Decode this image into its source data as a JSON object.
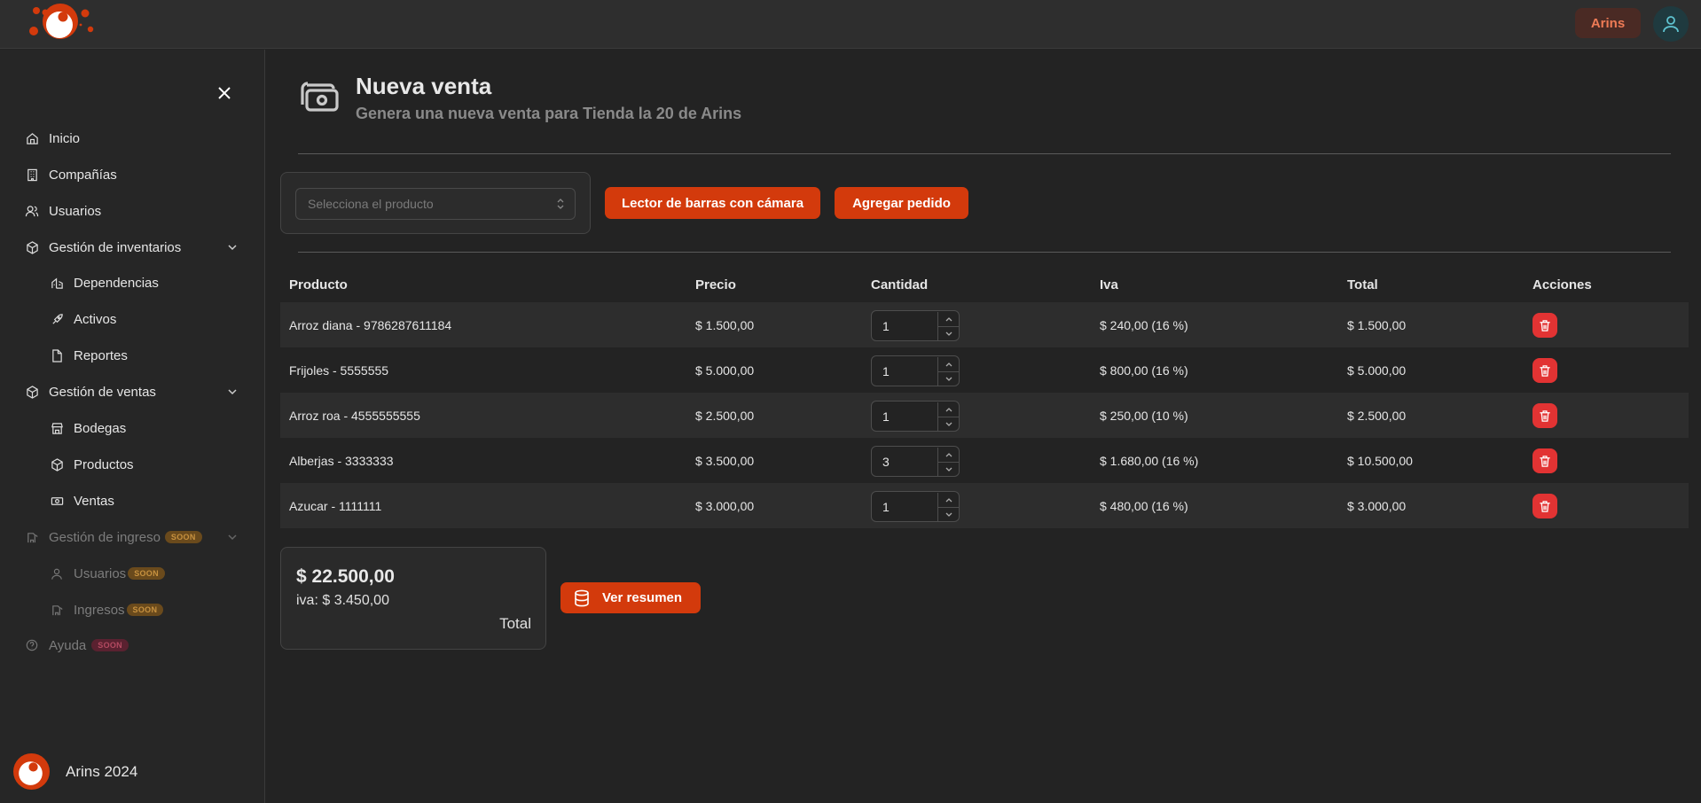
{
  "topbar": {
    "account_label": "Arins",
    "logo_icon": "arins-logo",
    "avatar_icon": "user-icon"
  },
  "sidebar": {
    "close_icon": "close-icon",
    "items": [
      {
        "label": "Inicio",
        "icon": "home-icon"
      },
      {
        "label": "Compañías",
        "icon": "building-icon"
      },
      {
        "label": "Usuarios",
        "icon": "users-icon"
      },
      {
        "label": "Gestión de inventarios",
        "icon": "box-icon",
        "expanded": true
      },
      {
        "label": "Dependencias",
        "icon": "dependencies-icon"
      },
      {
        "label": "Activos",
        "icon": "rocket-icon"
      },
      {
        "label": "Reportes",
        "icon": "document-icon"
      },
      {
        "label": "Gestión de ventas",
        "icon": "box-icon",
        "expanded": true
      },
      {
        "label": "Bodegas",
        "icon": "store-icon"
      },
      {
        "label": "Productos",
        "icon": "package-icon"
      },
      {
        "label": "Ventas",
        "icon": "cash-icon"
      },
      {
        "label": "Gestión de ingreso",
        "icon": "ingress-icon",
        "badge": "SOON"
      },
      {
        "label": "Usuarios",
        "icon": "user-icon",
        "badge": "SOON"
      },
      {
        "label": "Ingresos",
        "icon": "ingress-icon",
        "badge": "SOON"
      },
      {
        "label": "Ayuda",
        "icon": "help-icon",
        "badge": "SOON"
      }
    ],
    "footer": "Arins 2024"
  },
  "page": {
    "title": "Nueva venta",
    "subtitle": "Genera una nueva venta para Tienda la 20 de Arins",
    "header_icon": "cash-icon"
  },
  "toolbar": {
    "select_placeholder": "Selecciona el producto",
    "barcode_label": "Lector de barras con cámara",
    "add_order_label": "Agregar pedido"
  },
  "table": {
    "headers": [
      "Producto",
      "Precio",
      "Cantidad",
      "Iva",
      "Total",
      "Acciones"
    ],
    "rows": [
      {
        "product": "Arroz diana - 9786287611184",
        "price": "$ 1.500,00",
        "qty": "1",
        "iva": "$ 240,00 (16 %)",
        "total": "$ 1.500,00"
      },
      {
        "product": "Frijoles - 5555555",
        "price": "$ 5.000,00",
        "qty": "1",
        "iva": "$ 800,00 (16 %)",
        "total": "$ 5.000,00"
      },
      {
        "product": "Arroz roa - 4555555555",
        "price": "$ 2.500,00",
        "qty": "1",
        "iva": "$ 250,00 (10 %)",
        "total": "$ 2.500,00"
      },
      {
        "product": "Alberjas - 3333333",
        "price": "$ 3.500,00",
        "qty": "3",
        "iva": "$ 1.680,00 (16 %)",
        "total": "$ 10.500,00"
      },
      {
        "product": "Azucar - 1111111",
        "price": "$ 3.000,00",
        "qty": "1",
        "iva": "$ 480,00 (16 %)",
        "total": "$ 3.000,00"
      }
    ]
  },
  "summary": {
    "total_amount": "$ 22.500,00",
    "iva_line": "iva: $ 3.450,00",
    "total_label": "Total",
    "resumen_label": "Ver resumen",
    "resumen_icon": "database-icon"
  },
  "colors": {
    "accent": "#d33a0c",
    "delete": "#e23333",
    "background": "#232323"
  }
}
